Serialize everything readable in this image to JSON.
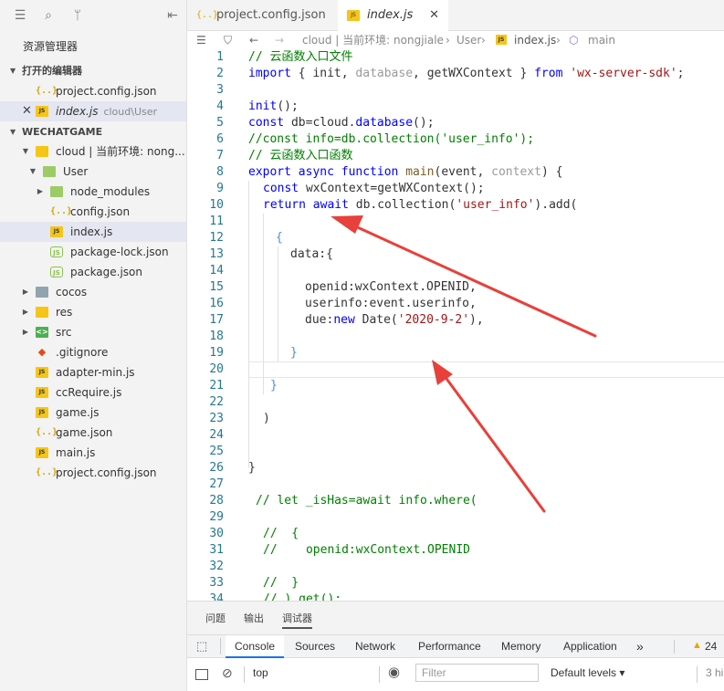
{
  "sidebar": {
    "explorer_title": "资源管理器",
    "open_editors_title": "打开的编辑器",
    "open_editors": [
      {
        "label": "project.config.json",
        "sub": ""
      },
      {
        "label": "index.js",
        "sub": "cloud\\User"
      }
    ],
    "workspace_title": "WECHATGAME",
    "tree": [
      {
        "label": "cloud | 当前环境: nong...",
        "icon": "folder-open-icon"
      },
      {
        "label": "User",
        "icon": "folder-open-icon"
      },
      {
        "label": "node_modules",
        "icon": "folder-icon"
      },
      {
        "label": "config.json",
        "icon": "json-icon"
      },
      {
        "label": "index.js",
        "icon": "js-icon"
      },
      {
        "label": "package-lock.json",
        "icon": "node-icon"
      },
      {
        "label": "package.json",
        "icon": "node-icon"
      },
      {
        "label": "cocos",
        "icon": "folder-icon"
      },
      {
        "label": "res",
        "icon": "folder-icon"
      },
      {
        "label": "src",
        "icon": "folder-icon"
      },
      {
        "label": ".gitignore",
        "icon": "git-icon"
      },
      {
        "label": "adapter-min.js",
        "icon": "js-icon"
      },
      {
        "label": "ccRequire.js",
        "icon": "js-icon"
      },
      {
        "label": "game.js",
        "icon": "js-icon"
      },
      {
        "label": "game.json",
        "icon": "json-icon"
      },
      {
        "label": "main.js",
        "icon": "js-icon"
      },
      {
        "label": "project.config.json",
        "icon": "json-icon"
      }
    ]
  },
  "tabs": [
    {
      "label": "project.config.json",
      "icon": "json-icon"
    },
    {
      "label": "index.js",
      "icon": "js-icon"
    }
  ],
  "breadcrumb": {
    "path": "cloud | 当前环境: nongjiale",
    "folder": "User",
    "file": "index.js",
    "symbol": "main"
  },
  "editor": {
    "line_numbers": [
      "1",
      "2",
      "3",
      "4",
      "5",
      "6",
      "7",
      "8",
      "9",
      "10",
      "11",
      "12",
      "13",
      "14",
      "15",
      "16",
      "17",
      "18",
      "19",
      "20",
      "21",
      "22",
      "23",
      "24",
      "25",
      "26",
      "27",
      "28",
      "29",
      "30",
      "31",
      "32",
      "33",
      "34"
    ],
    "comment_1": "// 云函数入口文件",
    "line2_import": "import",
    "line2_open": " { init, ",
    "line2_database": "database",
    "line2_rest": ", getWXContext } ",
    "line2_from": "from",
    "line2_module": "'wx-server-sdk'",
    "line2_end": ";",
    "line4_fn": "init",
    "line4_rest": "();",
    "line5_const": "const",
    "line5_rest": " db=cloud.",
    "line5_database": "database",
    "line5_end": "();",
    "line6_comment": "//const info=db.collection('user_info');",
    "line7_comment": "// 云函数入口函数",
    "line8_export": "export async function",
    "line8_main": " main",
    "line8_open": "(event, ",
    "line8_context": "context",
    "line8_end": ") {",
    "line9_const": "const",
    "line9_rest": " wxContext=getWXContext();",
    "line10_return": "return await",
    "line10_rest": " db.collection(",
    "line10_str": "'user_info'",
    "line10_end": ").add(",
    "line12_brace": "{",
    "line13": "data:{",
    "line15": "openid:wxContext.OPENID,",
    "line16": "userinfo:event.userinfo,",
    "line17_key": "due:",
    "line17_new": "new",
    "line17_date": " Date(",
    "line17_str": "'2020-9-2'",
    "line17_end": "),",
    "line19": "}",
    "line21_brace": "}",
    "line23": ")",
    "line26": "}",
    "line28": "// let _isHas=await info.where(",
    "line30": "//  {",
    "line31": "//    openid:wxContext.OPENID",
    "line33": "//  }",
    "line34": "// ).get();"
  },
  "panel": {
    "tabs": [
      "问题",
      "输出",
      "调试器"
    ],
    "devtools_tabs": [
      "Console",
      "Sources",
      "Network",
      "Performance",
      "Memory",
      "Application"
    ],
    "more": "»",
    "warning_count": "24",
    "context": "top",
    "filter_placeholder": "Filter",
    "levels": "Default levels",
    "hidden": "3 hi"
  },
  "colors": {
    "arrow": "#e8403a",
    "keyword": "#0000ff",
    "comment": "#008000",
    "string": "#a31515"
  }
}
